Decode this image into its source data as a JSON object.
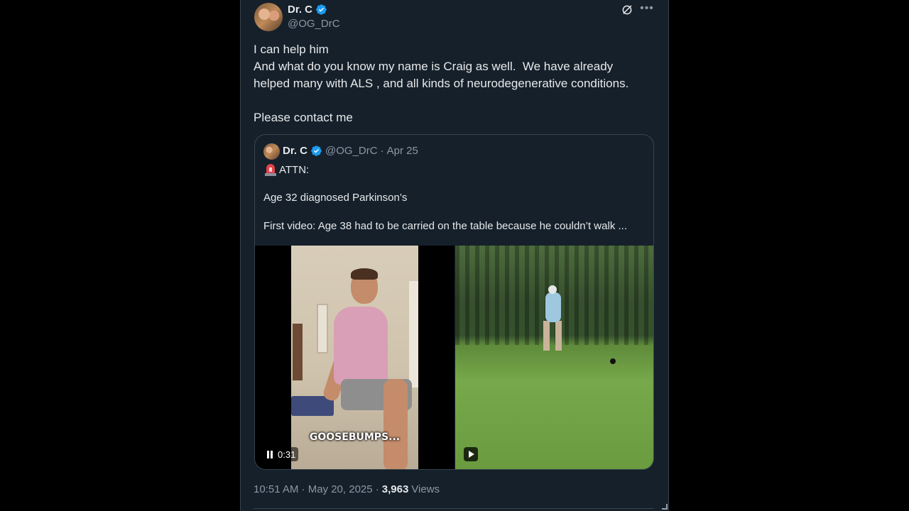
{
  "tweet": {
    "author_name": "Dr. C",
    "author_handle": "@OG_DrC",
    "text_lines": [
      "I can help him",
      "And what do you know my name is Craig as well.  We have already",
      "helped many with ALS , and all kinds of neurodegenerative conditions.",
      "",
      "Please contact me"
    ],
    "timestamp": "10:51 AM · May 20, 2025 · ",
    "views_count": "3,963",
    "views_label": "Views"
  },
  "quote": {
    "author_name": "Dr. C",
    "author_handle": "@OG_DrC",
    "separator": "·",
    "date": "Apr 25",
    "line1": "ATTN:",
    "line2": "Age 32 diagnosed Parkinson’s",
    "line3": "First video: Age 38 had to be carried on the table because he couldn’t walk ...",
    "video1": {
      "caption": "GOOSEBUMPS...",
      "duration": "0:31"
    }
  },
  "colors": {
    "background": "#15202b",
    "border": "#38444d",
    "verified": "#1d9bf0",
    "secondary_text": "#8b98a5"
  },
  "icons": [
    "verified-badge-icon",
    "grok-icon",
    "more-icon",
    "siren-emoji-icon",
    "pause-icon",
    "play-icon"
  ]
}
